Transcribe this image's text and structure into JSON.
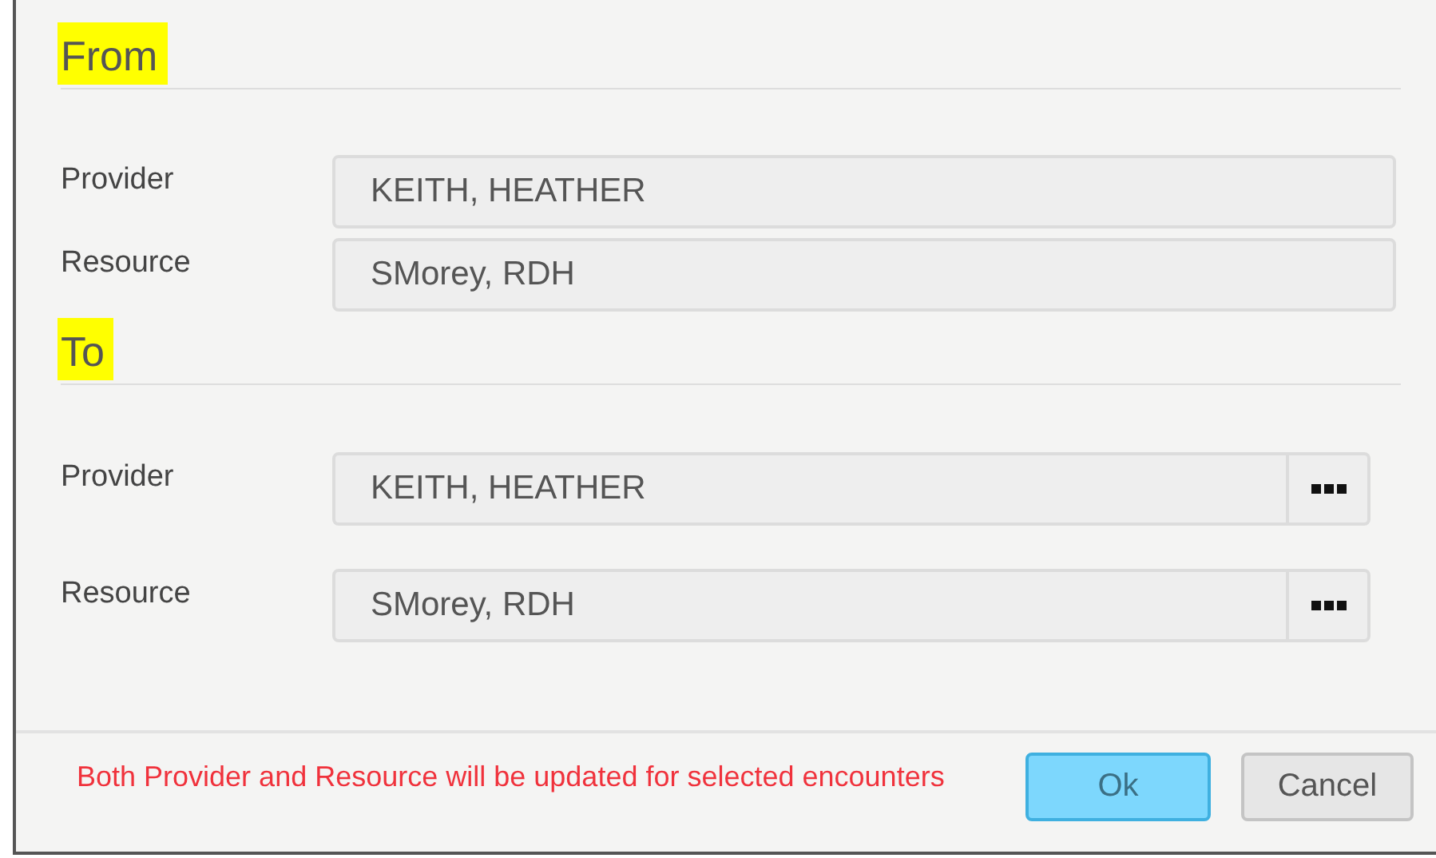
{
  "sections": [
    {
      "heading": "From",
      "highlighted": true,
      "rows": [
        {
          "label": "Provider",
          "value": "KEITH, HEATHER",
          "has_picker": false
        },
        {
          "label": "Resource",
          "value": "SMorey, RDH",
          "has_picker": false
        }
      ]
    },
    {
      "heading": "To",
      "highlighted": true,
      "rows": [
        {
          "label": "Provider",
          "value": "KEITH, HEATHER",
          "has_picker": true
        },
        {
          "label": "Resource",
          "value": "SMorey, RDH",
          "has_picker": true
        }
      ]
    }
  ],
  "footer": {
    "message": "Both Provider and Resource will be updated for selected encounters",
    "buttons": [
      {
        "label": "Ok",
        "primary": true
      },
      {
        "label": "Cancel",
        "primary": false
      }
    ]
  }
}
